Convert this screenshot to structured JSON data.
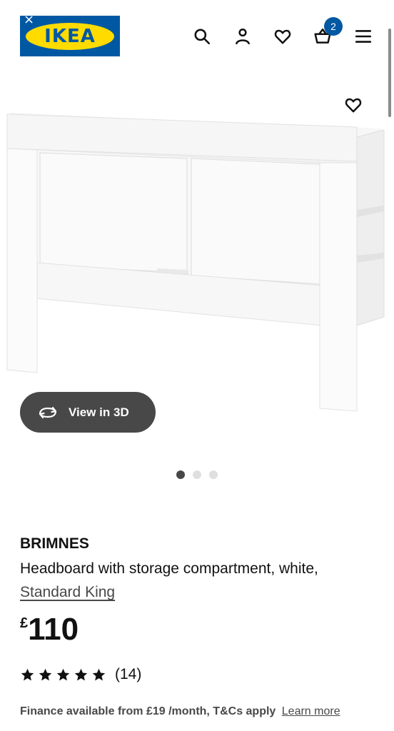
{
  "header": {
    "logo_text": "IKEA",
    "close_symbol": "×",
    "icons": [
      "search-icon",
      "account-icon",
      "heart-icon",
      "basket-icon",
      "menu-icon"
    ],
    "basket_count": "2"
  },
  "gallery": {
    "view3d_label": "View in 3D",
    "image_count": 3,
    "active_image_index": 0
  },
  "product": {
    "name": "BRIMNES",
    "description": "Headboard with storage compartment, white,",
    "size_link": "Standard King",
    "currency": "£",
    "price": "110",
    "rating_stars": 5,
    "review_count": "(14)"
  },
  "finance": {
    "text": "Finance available from £19 /month, T&Cs apply",
    "link": "Learn more"
  },
  "colors": {
    "ikea_blue": "#0058a3",
    "ikea_yellow": "#ffdb00",
    "dark_gray": "#484848"
  }
}
